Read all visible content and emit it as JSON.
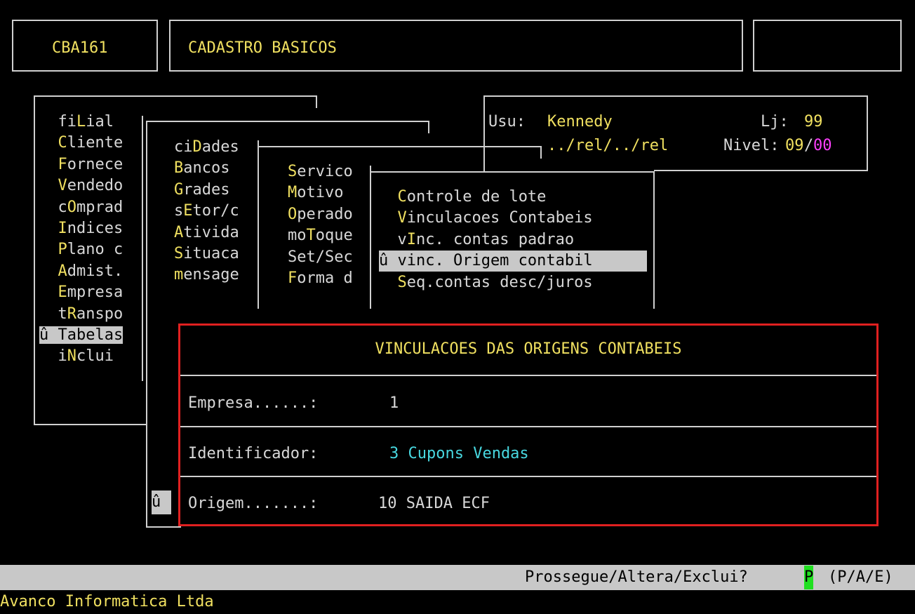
{
  "header": {
    "program_code": "CBA161",
    "title": "CADASTRO BASICOS",
    "right_box": ""
  },
  "info": {
    "user_label": "Usu:",
    "user_value": "Kennedy",
    "store_label": "Lj:",
    "store_value": "99",
    "path": "../rel/../rel",
    "level_label": "Nivel:",
    "level_value_a": "09",
    "level_sep": "/",
    "level_value_b": "00"
  },
  "menu1": {
    "items": [
      {
        "hot": "",
        "k": "fi",
        "h": "L",
        "r": "ial"
      },
      {
        "hot": "C",
        "rest": "liente"
      },
      {
        "hot": "F",
        "rest": "ornece"
      },
      {
        "hot": "V",
        "rest": "endedo"
      },
      {
        "pre": "c",
        "hot": "O",
        "rest": "mprad"
      },
      {
        "hot": "I",
        "rest": "ndices"
      },
      {
        "hot": "P",
        "rest": "lano c"
      },
      {
        "hot": "A",
        "rest": "dmist."
      },
      {
        "hot": "E",
        "rest": "mpresa"
      },
      {
        "pre": "t",
        "hot": "R",
        "rest": "anspo"
      },
      {
        "selected": "û Tabelas"
      },
      {
        "pre": "i",
        "hot": "N",
        "rest": "clui"
      }
    ]
  },
  "menu2": {
    "items": [
      {
        "pre": "ci",
        "hot": "D",
        "rest": "ades"
      },
      {
        "hot": "B",
        "rest": "ancos"
      },
      {
        "hot": "G",
        "rest": "rades"
      },
      {
        "pre": "s",
        "hot": "E",
        "rest": "tor/c"
      },
      {
        "hot": "A",
        "rest": "tivida"
      },
      {
        "hot": "S",
        "rest": "ituaca"
      },
      {
        "pre": "",
        "hot": "m",
        "rest": "ensage"
      }
    ],
    "marker": "û"
  },
  "menu3": {
    "items": [
      {
        "hot": "S",
        "rest": "ervico"
      },
      {
        "hot": "M",
        "rest": "otivo"
      },
      {
        "hot": "O",
        "rest": "perado"
      },
      {
        "pre": "mo",
        "hot": "T",
        "rest": "oque"
      },
      {
        "pre": "Set/Sec",
        "hot": "",
        "rest": ""
      },
      {
        "hot": "F",
        "rest": "orma d"
      }
    ]
  },
  "menu4": {
    "items": [
      {
        "hot": "C",
        "rest": "ontrole de lote"
      },
      {
        "hot": "V",
        "rest": "inculacoes Contabeis"
      },
      {
        "pre": "v",
        "hot": "I",
        "rest": "nc. contas padrao"
      },
      {
        "selected": "û vinc. Origem contabil"
      },
      {
        "hot": "S",
        "rest": "eq.contas desc/juros"
      }
    ]
  },
  "dialog": {
    "title": "VINCULACOES DAS ORIGENS CONTABEIS",
    "empresa_label": "Empresa......:",
    "empresa_value": "1",
    "ident_label": "Identificador:",
    "ident_value": "3 Cupons Vendas",
    "origem_label": "Origem.......:",
    "origem_value": "10 SAIDA ECF"
  },
  "status": {
    "prompt": "Prossegue/Altera/Exclui?",
    "answer": "P",
    "options": "(P/A/E)"
  },
  "footer": {
    "company": "Avanco Informatica Ltda"
  },
  "colors": {
    "background": "#000000",
    "hotkey": "#f0e060",
    "text": "#d8d8d8",
    "cyan_value": "#48d8e0",
    "magenta_value": "#ff40ff",
    "dialog_border": "#e02020",
    "status_bar": "#c8c8c8",
    "answer_bg": "#20e020"
  }
}
